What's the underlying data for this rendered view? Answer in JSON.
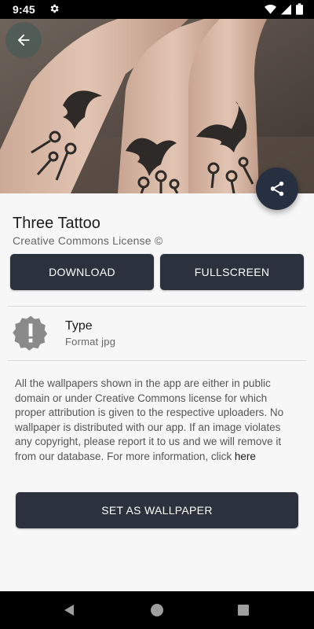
{
  "status_bar": {
    "time": "9:45"
  },
  "header": {
    "image_subject": "three forearms with bird and key tattoos"
  },
  "details": {
    "title": "Three Tattoo",
    "license": "Creative Commons License ©"
  },
  "actions": {
    "download_label": "DOWNLOAD",
    "fullscreen_label": "FULLSCREEN",
    "set_wallpaper_label": "SET AS WALLPAPER"
  },
  "type_info": {
    "label": "Type",
    "value": "Format jpg"
  },
  "notice": {
    "text": "All the wallpapers shown in the app are either in public domain or under Creative Commons license for which proper attribution is given to the respective uploaders. No wallpaper is distributed with our app. If an image violates any copyright, please report it to us and we will remove it from our database. For more information, click ",
    "link": "here"
  },
  "colors": {
    "primary_dark": "#2b323d",
    "fab": "#273040",
    "background": "#f7f7f7"
  },
  "icons": {
    "back": "arrow-left-icon",
    "share": "share-icon",
    "type": "alert-badge-icon",
    "status_settings": "gear-icon",
    "wifi": "wifi-icon",
    "signal": "signal-icon",
    "battery": "battery-icon"
  }
}
